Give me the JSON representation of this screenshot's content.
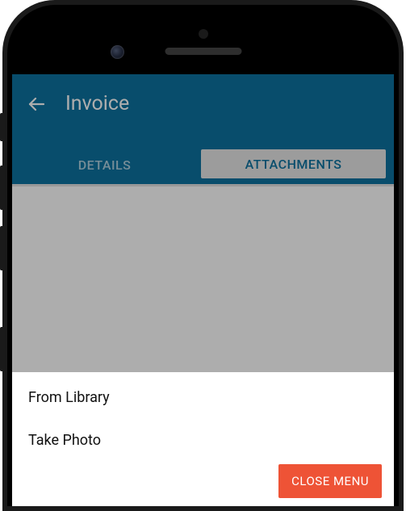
{
  "header": {
    "title": "Invoice",
    "back_icon": "arrow-back"
  },
  "tabs": {
    "details_label": "DETAILS",
    "attachments_label": "ATTACHMENTS",
    "active": "attachments"
  },
  "action_sheet": {
    "items": [
      {
        "label": "From Library"
      },
      {
        "label": "Take Photo"
      }
    ],
    "close_label": "CLOSE MENU"
  },
  "colors": {
    "header_bg": "#0c72a0",
    "accent": "#ee5336"
  }
}
